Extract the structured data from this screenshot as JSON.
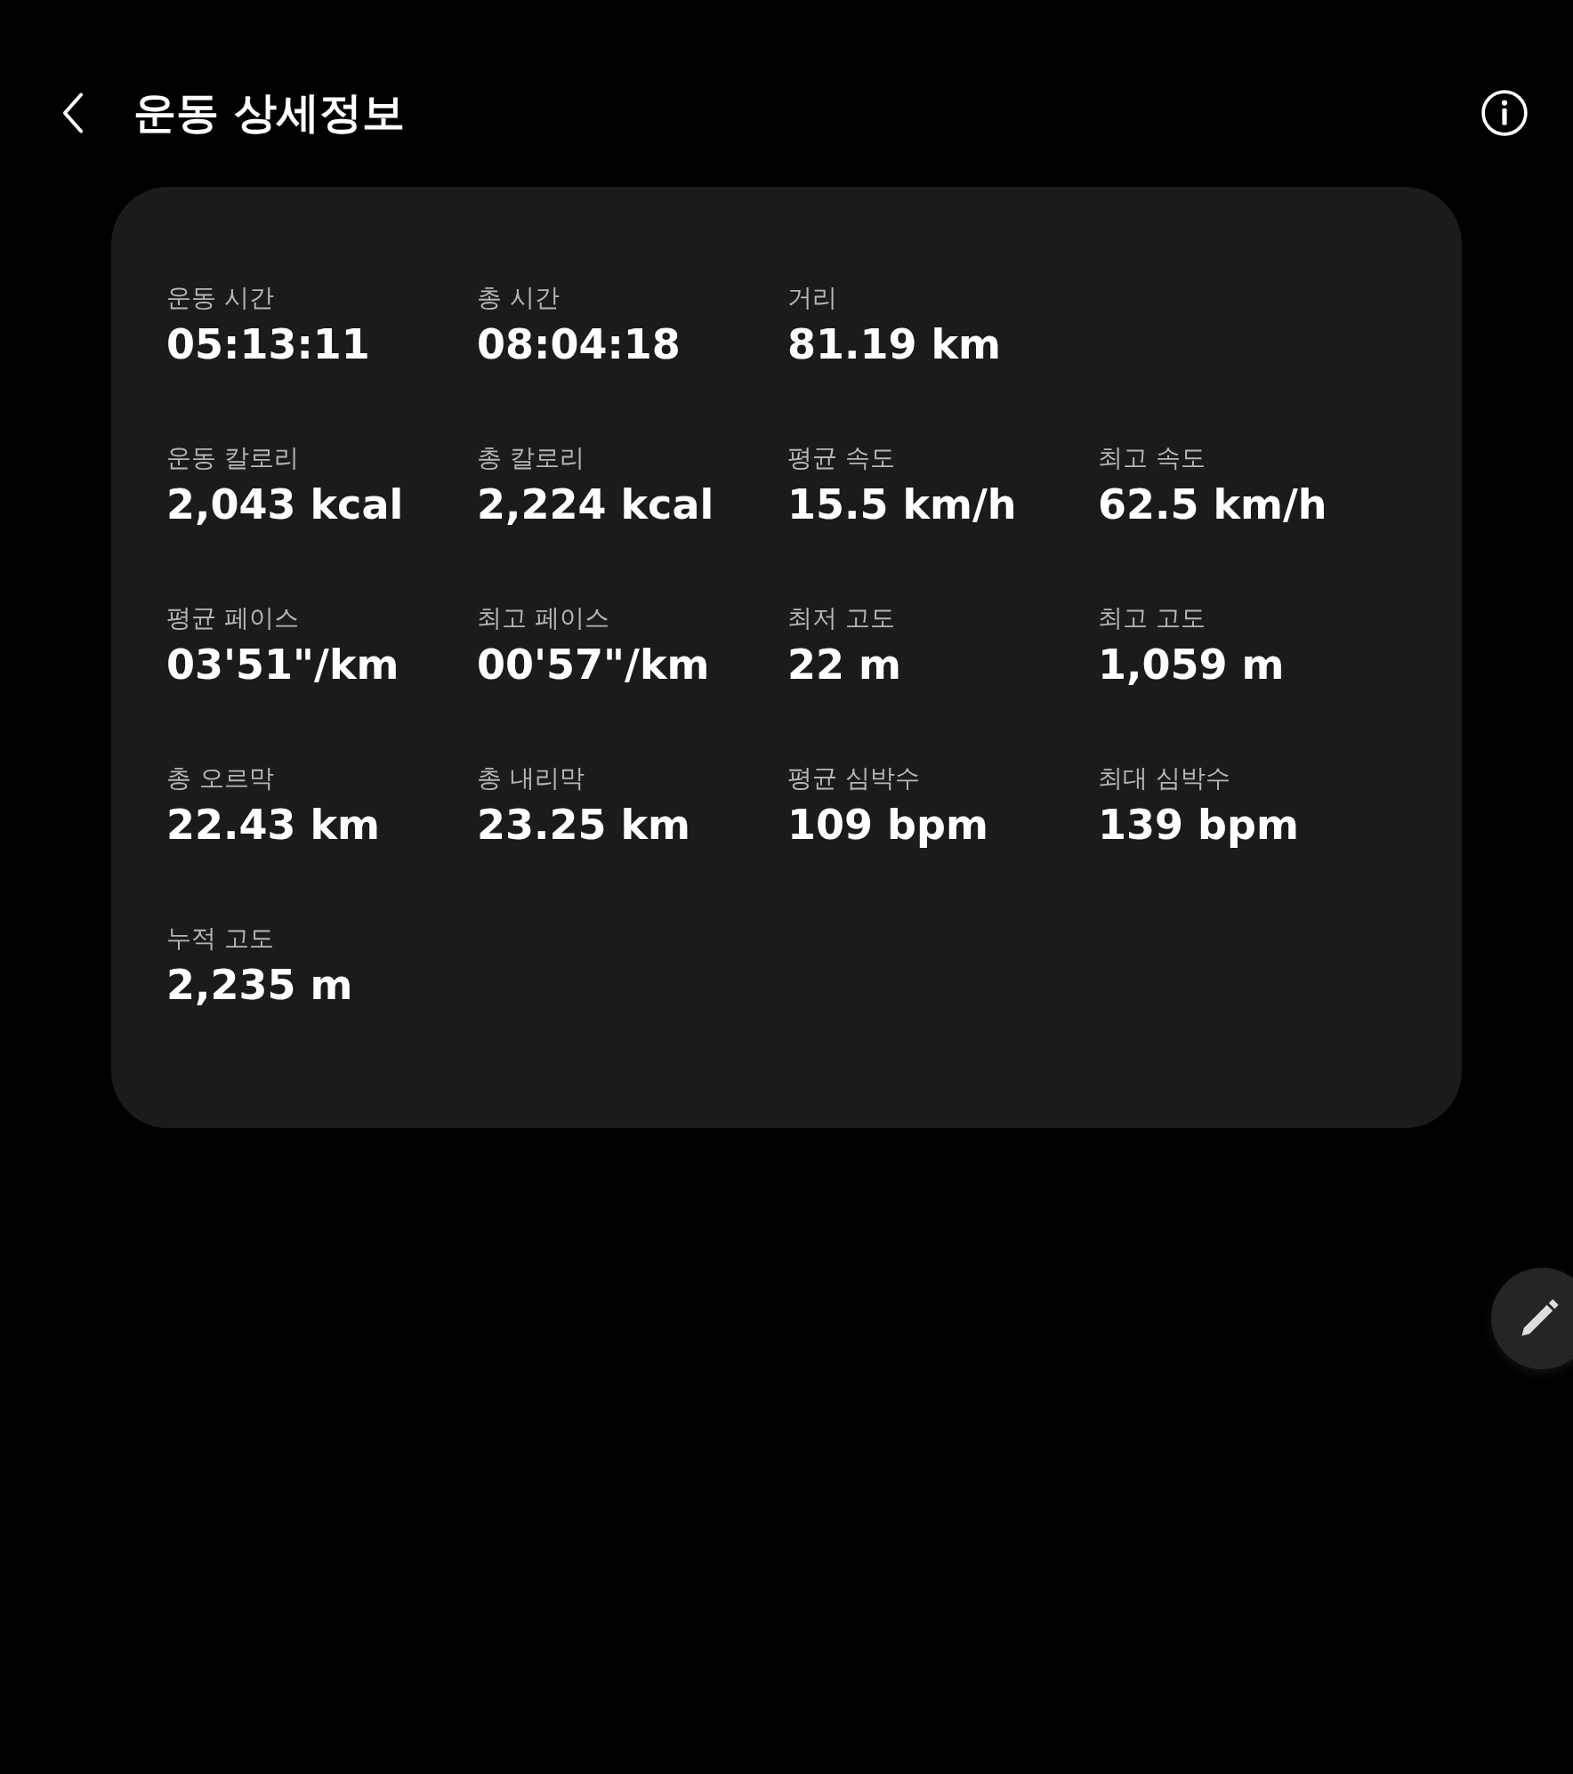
{
  "header": {
    "title": "운동 상세정보"
  },
  "rows": [
    {
      "stats": [
        {
          "label": "운동 시간",
          "value": "05:13:11"
        },
        {
          "label": "총 시간",
          "value": "08:04:18"
        },
        {
          "label": "거리",
          "value": "81.19 km"
        }
      ]
    },
    {
      "stats": [
        {
          "label": "운동 칼로리",
          "value": "2,043 kcal"
        },
        {
          "label": "총 칼로리",
          "value": "2,224 kcal"
        },
        {
          "label": "평균 속도",
          "value": "15.5 km/h"
        },
        {
          "label": "최고 속도",
          "value": "62.5 km/h"
        }
      ]
    },
    {
      "stats": [
        {
          "label": "평균 페이스",
          "value": "03'51\"/km"
        },
        {
          "label": "최고 페이스",
          "value": "00'57\"/km"
        },
        {
          "label": "최저 고도",
          "value": "22 m"
        },
        {
          "label": "최고 고도",
          "value": "1,059 m"
        }
      ]
    },
    {
      "stats": [
        {
          "label": "총 오르막",
          "value": "22.43 km"
        },
        {
          "label": "총 내리막",
          "value": "23.25 km"
        },
        {
          "label": "평균 심박수",
          "value": "109 bpm"
        },
        {
          "label": "최대 심박수",
          "value": "139 bpm"
        }
      ]
    },
    {
      "stats": [
        {
          "label": "누적 고도",
          "value": "2,235 m"
        }
      ]
    }
  ]
}
